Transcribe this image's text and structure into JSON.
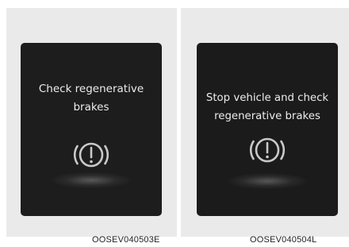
{
  "figures": [
    {
      "message": "Check regenerative\nbrakes",
      "icon": "brake-warning-icon",
      "code": "OOSEV040503E"
    },
    {
      "message": "Stop vehicle and check\nregenerative brakes",
      "icon": "brake-warning-icon",
      "code": "OOSEV040504L"
    }
  ]
}
